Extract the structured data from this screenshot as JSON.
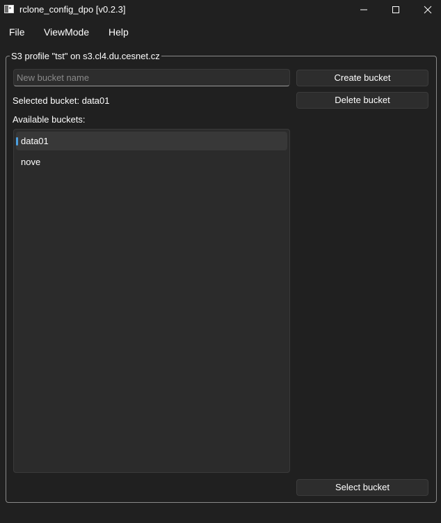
{
  "window": {
    "title": "rclone_config_dpo [v0.2.3]",
    "icon": "app-window-icon",
    "controls": [
      "minimize-icon",
      "maximize-icon",
      "close-icon"
    ]
  },
  "menu": {
    "items": [
      {
        "label": "File"
      },
      {
        "label": "ViewMode"
      },
      {
        "label": "Help"
      }
    ]
  },
  "group": {
    "title": "S3 profile \"tst\" on s3.cl4.du.cesnet.cz"
  },
  "bucket_input": {
    "value": "",
    "placeholder": "New bucket name"
  },
  "buttons": {
    "create": "Create bucket",
    "delete": "Delete bucket",
    "select": "Select bucket"
  },
  "selected_label": "Selected bucket: data01",
  "available_label": "Available buckets:",
  "buckets": [
    {
      "name": "data01",
      "selected": true
    },
    {
      "name": "nove",
      "selected": false
    }
  ],
  "colors": {
    "background": "#202020",
    "panel": "#2b2b2b",
    "accent": "#4ca0e0"
  }
}
